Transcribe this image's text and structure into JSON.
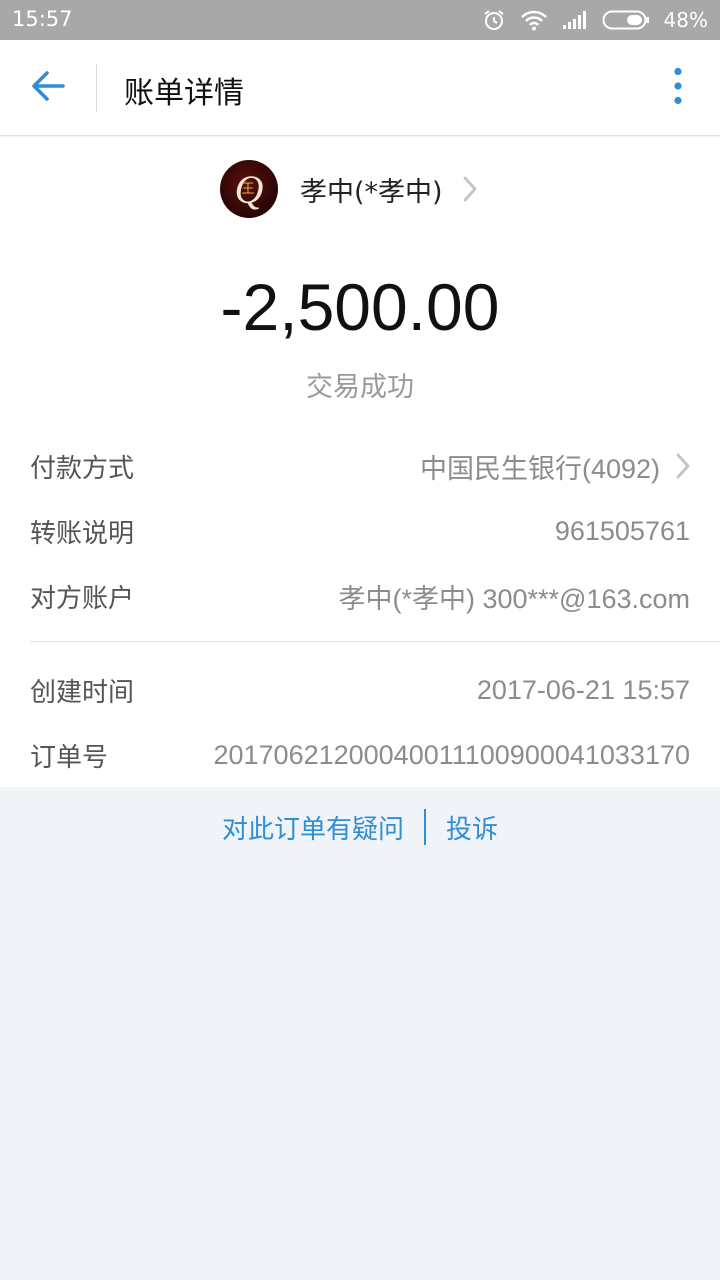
{
  "statusbar": {
    "time": "15:57",
    "battery": "48%"
  },
  "header": {
    "title": "账单详情"
  },
  "payee": {
    "name": "孝中(*孝中)",
    "avatar_letter": "Q",
    "avatar_mark": "王"
  },
  "transaction": {
    "amount": "-2,500.00",
    "status": "交易成功"
  },
  "details": [
    {
      "label": "付款方式",
      "value": "中国民生银行(4092)"
    },
    {
      "label": "转账说明",
      "value": "961505761"
    },
    {
      "label": "对方账户",
      "value": "孝中(*孝中) 300***@163.com"
    },
    {
      "label": "创建时间",
      "value": "2017-06-21 15:57"
    },
    {
      "label": "订单号",
      "value": "20170621200040011100900041033170"
    }
  ],
  "footer": {
    "question_link": "对此订单有疑问",
    "complaint_link": "投诉"
  },
  "colors": {
    "accent": "#2e8ed6",
    "statusbar": "#a8a8a8",
    "page_bg": "#f0f3f7"
  },
  "icons": [
    "back-arrow-icon",
    "more-vert-icon",
    "chevron-right-icon",
    "alarm-icon",
    "wifi-icon",
    "signal-icon",
    "battery-icon"
  ]
}
